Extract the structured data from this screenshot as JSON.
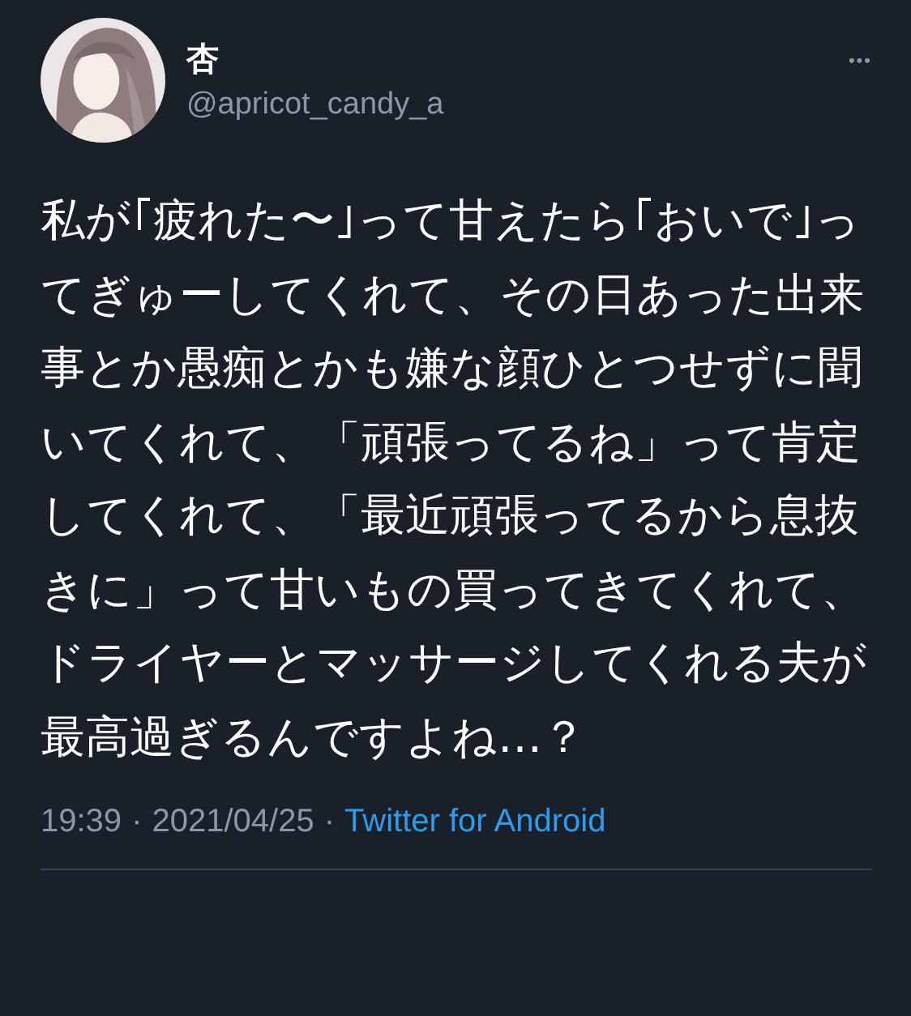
{
  "author": {
    "name": "杏",
    "handle": "@apricot_candy_a"
  },
  "more_icon": "•••",
  "text": "私が｢疲れた〜｣って甘えたら｢おいで｣ってぎゅーしてくれて、その日あった出来事とか愚痴とかも嫌な顔ひとつせずに聞いてくれて、「頑張ってるね」って肯定してくれて、「最近頑張ってるから息抜きに」って甘いもの買ってきてくれて、ドライヤーとマッサージしてくれる夫が最高過ぎるんですよね…？",
  "meta": {
    "time": "19:39",
    "separator": "·",
    "date": "2021/04/25",
    "source": "Twitter for Android"
  }
}
